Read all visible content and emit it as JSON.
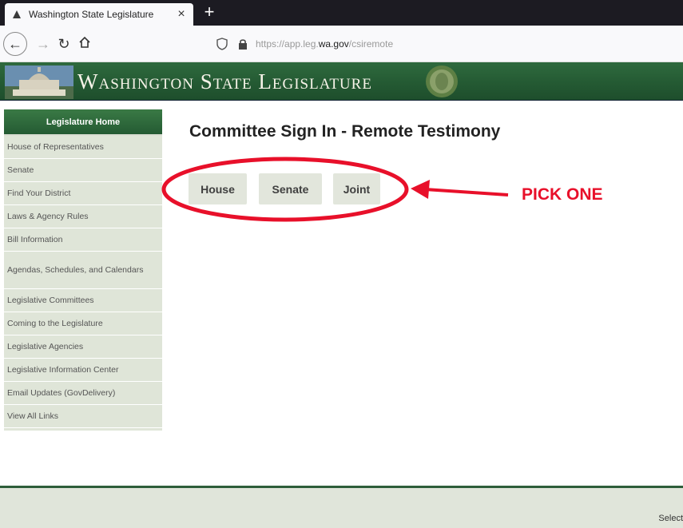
{
  "browser": {
    "tab_title": "Washington State Legislature",
    "tab_close": "×",
    "new_tab": "+",
    "url_prefix": "https://app.leg.",
    "url_domain": "wa.gov",
    "url_path": "/csiremote"
  },
  "site": {
    "banner_title": "Washington State Legislature"
  },
  "sidebar": {
    "header": "Legislature Home",
    "items": [
      "House of Representatives",
      "Senate",
      "Find Your District",
      "Laws & Agency Rules",
      "Bill Information",
      "Agendas, Schedules, and Calendars",
      "Legislative Committees",
      "Coming to the Legislature",
      "Legislative Agencies",
      "Legislative Information Center",
      "Email Updates (GovDelivery)",
      "View All Links"
    ]
  },
  "main": {
    "title": "Committee Sign In - Remote Testimony",
    "buttons": {
      "house": "House",
      "senate": "Senate",
      "joint": "Joint"
    }
  },
  "annotation": {
    "label": "PICK ONE",
    "color": "#e8102a"
  },
  "footer": {
    "text": "Select"
  },
  "colors": {
    "brand_green": "#245a33",
    "sidebar_bg": "#dfe5d8",
    "button_bg": "#e2e6dc"
  }
}
